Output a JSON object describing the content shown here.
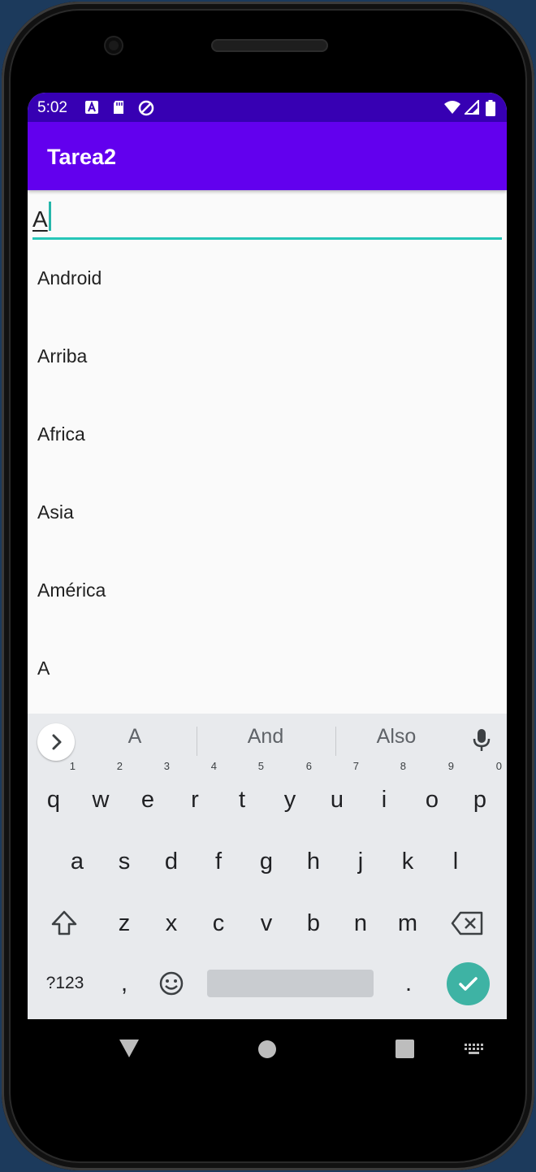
{
  "status_bar": {
    "time": "5:02",
    "left_icons": [
      "text-format-icon",
      "sd-card-icon",
      "no-disturb-icon"
    ],
    "right_icons": [
      "wifi-icon",
      "signal-icon",
      "battery-icon"
    ]
  },
  "app_bar": {
    "title": "Tarea2"
  },
  "search": {
    "value": "A"
  },
  "list": {
    "items": [
      "Android",
      "Arriba",
      "Africa",
      "Asia",
      "América",
      "A"
    ]
  },
  "keyboard": {
    "suggestions": [
      "A",
      "And",
      "Also"
    ],
    "row1": [
      "q",
      "w",
      "e",
      "r",
      "t",
      "y",
      "u",
      "i",
      "o",
      "p"
    ],
    "row1_hints": [
      "1",
      "2",
      "3",
      "4",
      "5",
      "6",
      "7",
      "8",
      "9",
      "0"
    ],
    "row2": [
      "a",
      "s",
      "d",
      "f",
      "g",
      "h",
      "j",
      "k",
      "l"
    ],
    "row3": [
      "z",
      "x",
      "c",
      "v",
      "b",
      "n",
      "m"
    ],
    "bottom": {
      "symbols": "?123",
      "comma": ",",
      "period": "."
    }
  },
  "colors": {
    "status_bar": "#3700b3",
    "app_bar": "#6200ee",
    "accent": "#26c6b8",
    "enter_key": "#3eb3a4"
  }
}
